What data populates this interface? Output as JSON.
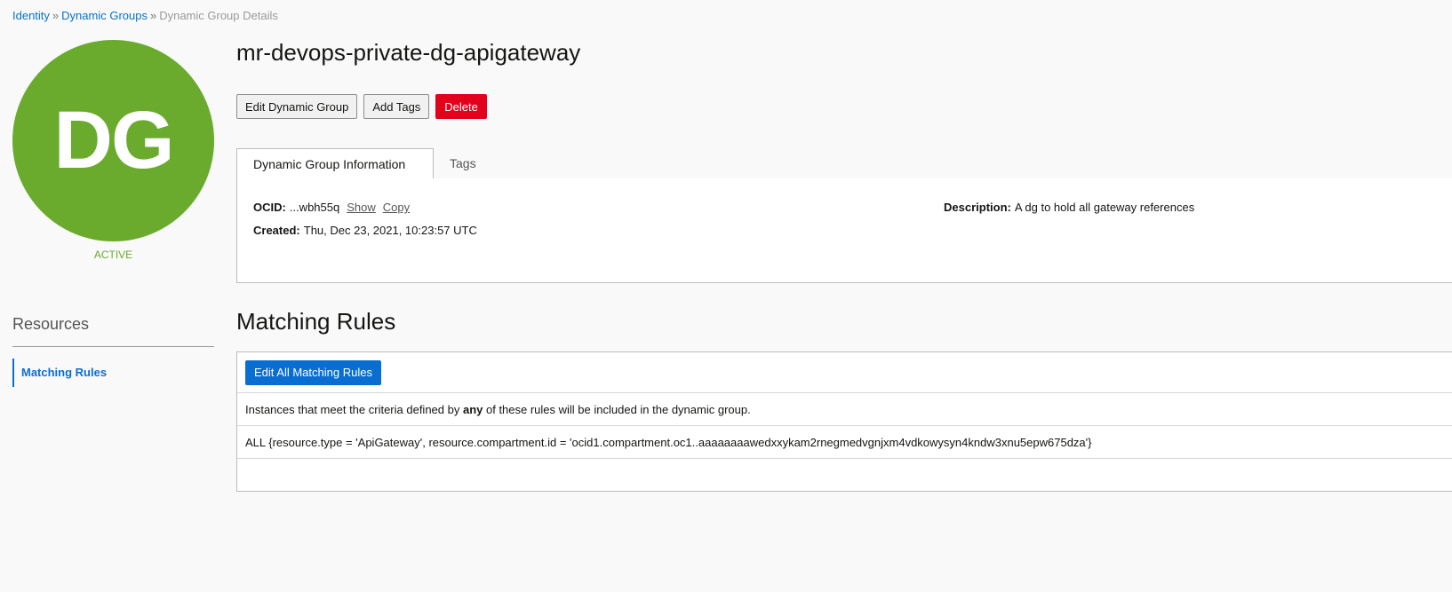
{
  "breadcrumb": {
    "items": [
      "Identity",
      "Dynamic Groups"
    ],
    "separator": "»",
    "current": "Dynamic Group Details"
  },
  "avatar": {
    "initials": "DG",
    "status": "ACTIVE",
    "color": "#6aab2d"
  },
  "page_title": "mr-devops-private-dg-apigateway",
  "actions": {
    "edit_label": "Edit Dynamic Group",
    "add_tags_label": "Add Tags",
    "delete_label": "Delete"
  },
  "tabs": {
    "info_label": "Dynamic Group Information",
    "tags_label": "Tags"
  },
  "info": {
    "ocid_label": "OCID:",
    "ocid_value": "...wbh55q",
    "show_label": "Show",
    "copy_label": "Copy",
    "created_label": "Created:",
    "created_value": "Thu, Dec 23, 2021, 10:23:57 UTC",
    "description_label": "Description:",
    "description_value": "A dg to hold all gateway references"
  },
  "resources": {
    "title": "Resources",
    "items": [
      "Matching Rules"
    ]
  },
  "matching_rules": {
    "title": "Matching Rules",
    "edit_label": "Edit All Matching Rules",
    "criteria_before": "Instances that meet the criteria defined by ",
    "criteria_emphasis": "any",
    "criteria_after": " of these rules will be included in the dynamic group.",
    "rule": "ALL {resource.type = 'ApiGateway', resource.compartment.id = 'ocid1.compartment.oc1..aaaaaaaawedxxykam2rnegmedvgnjxm4vdkowysyn4kndw3xnu5epw675dza'}"
  },
  "colors": {
    "accent": "#0a6ed1",
    "danger": "#e2001a",
    "active": "#6aab2d"
  }
}
